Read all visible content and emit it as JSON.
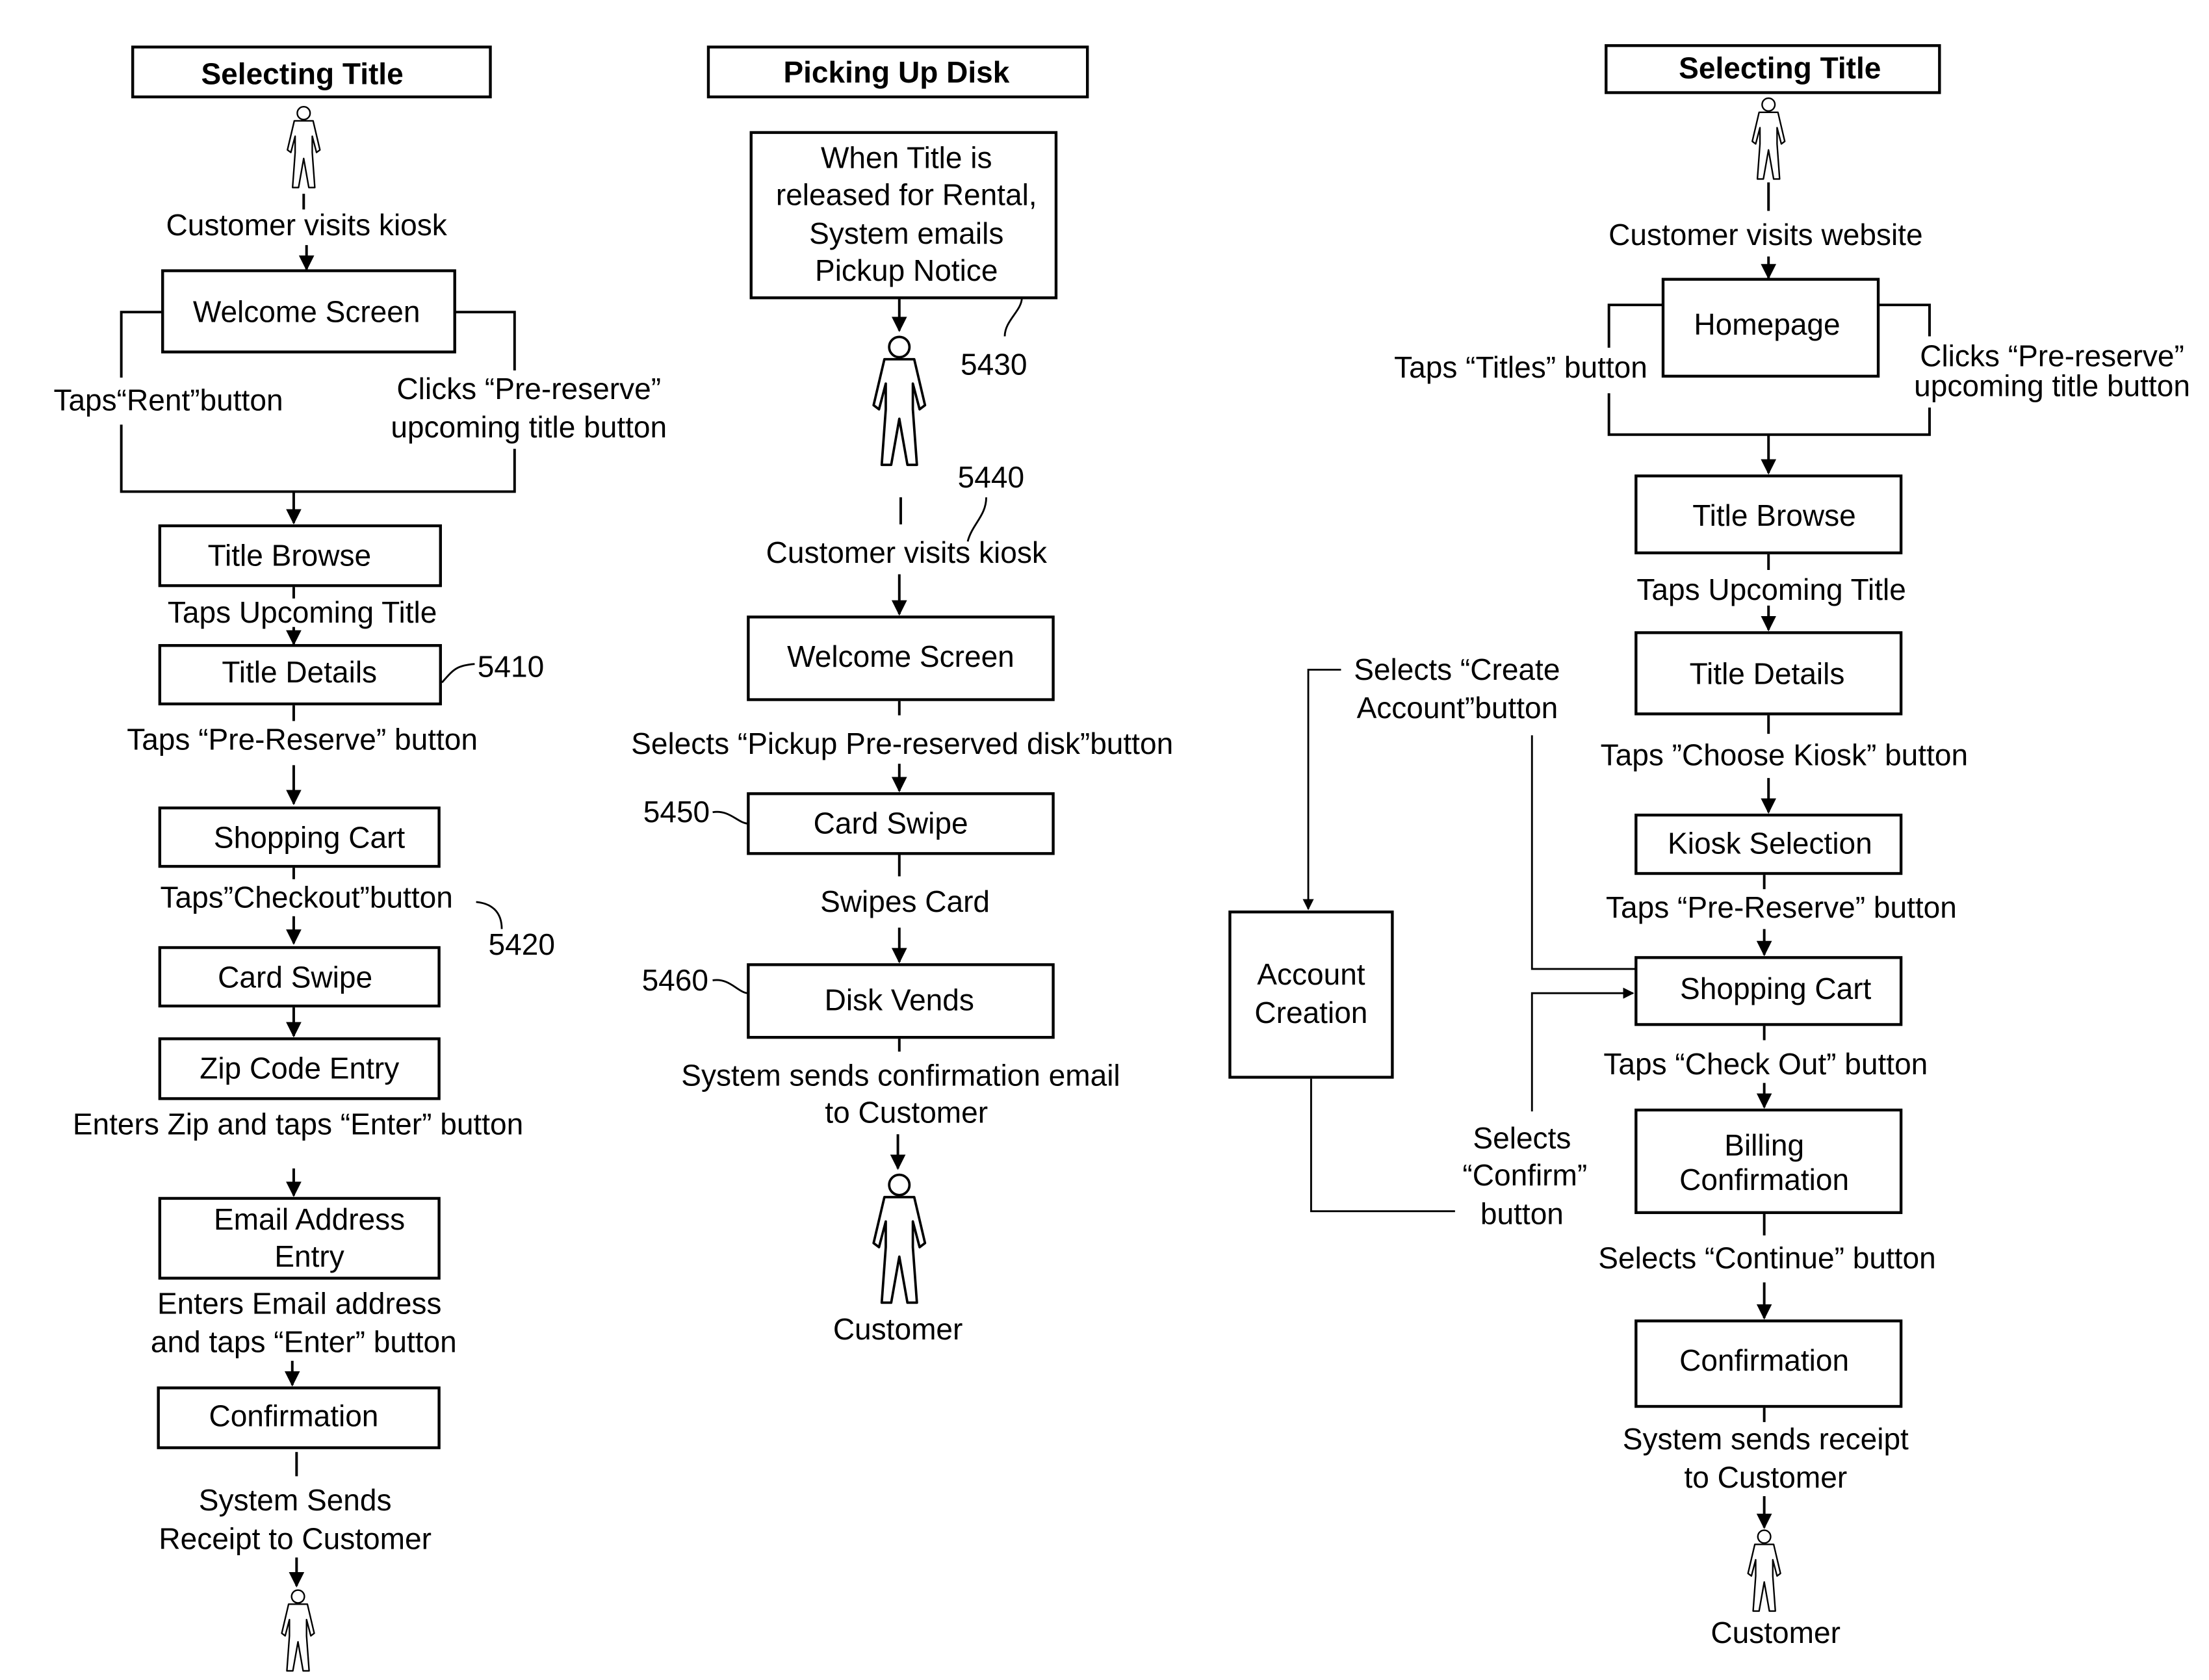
{
  "columns": {
    "kiosk_select": {
      "header": "Selecting Title",
      "start_label": "Customer visits kiosk",
      "welcome_box": "Welcome Screen",
      "branch_left": "Taps“Rent”button",
      "branch_right": [
        "Clicks “Pre-reserve”",
        "upcoming title button"
      ],
      "title_browse": "Title Browse",
      "taps_upcoming": "Taps Upcoming Title",
      "title_details": "Title Details",
      "ref_title_details": "5410",
      "taps_prereserve": "Taps  “Pre-Reserve” button",
      "shopping_cart": "Shopping Cart",
      "taps_checkout": "Taps”Checkout”button",
      "ref_checkout": "5420",
      "card_swipe": "Card Swipe",
      "zip_entry": "Zip Code Entry",
      "enters_zip": "Enters Zip and taps  “Enter” button",
      "email_entry": [
        "Email Address",
        "Entry"
      ],
      "enters_email": [
        "Enters Email address",
        "and taps  “Enter” button"
      ],
      "confirmation": "Confirmation",
      "receipt": [
        "System Sends",
        "Receipt to Customer"
      ]
    },
    "pickup": {
      "header": "Picking Up Disk",
      "release_box": [
        "When Title is",
        "released for Rental,",
        "System emails",
        "Pickup Notice"
      ],
      "ref_release": "5430",
      "ref_visit": "5440",
      "visit_label": "Customer visits kiosk",
      "welcome_box": "Welcome Screen",
      "selects_pickup": "Selects “Pickup Pre-reserved disk”button",
      "card_swipe": "Card Swipe",
      "ref_card_swipe": "5450",
      "swipes_card": "Swipes Card",
      "disk_vends": "Disk Vends",
      "ref_disk_vends": "5460",
      "confirm_email": [
        "System sends confirmation email",
        "to Customer"
      ],
      "customer_label": "Customer"
    },
    "web_select": {
      "header": "Selecting Title",
      "start_label": "Customer visits website",
      "homepage": "Homepage",
      "branch_left": "Taps “Titles” button",
      "branch_right": [
        "Clicks “Pre-reserve”",
        "upcoming title button"
      ],
      "title_browse": "Title Browse",
      "taps_upcoming": "Taps Upcoming Title",
      "title_details": "Title Details",
      "create_account": [
        "Selects “Create",
        "Account”button"
      ],
      "account_creation": [
        "Account",
        "Creation"
      ],
      "taps_choose_kiosk": "Taps ”Choose Kiosk” button",
      "kiosk_selection": "Kiosk Selection",
      "taps_prereserve": "Taps “Pre-Reserve” button",
      "shopping_cart": "Shopping Cart",
      "taps_checkout": "Taps “Check Out” button",
      "selects_confirm": [
        "Selects",
        "“Confirm”",
        "button"
      ],
      "billing_confirmation": [
        "Billing",
        "Confirmation"
      ],
      "selects_continue": "Selects “Continue” button",
      "confirmation": "Confirmation",
      "receipt": [
        "System sends receipt",
        "to Customer"
      ],
      "customer_label": "Customer"
    }
  }
}
